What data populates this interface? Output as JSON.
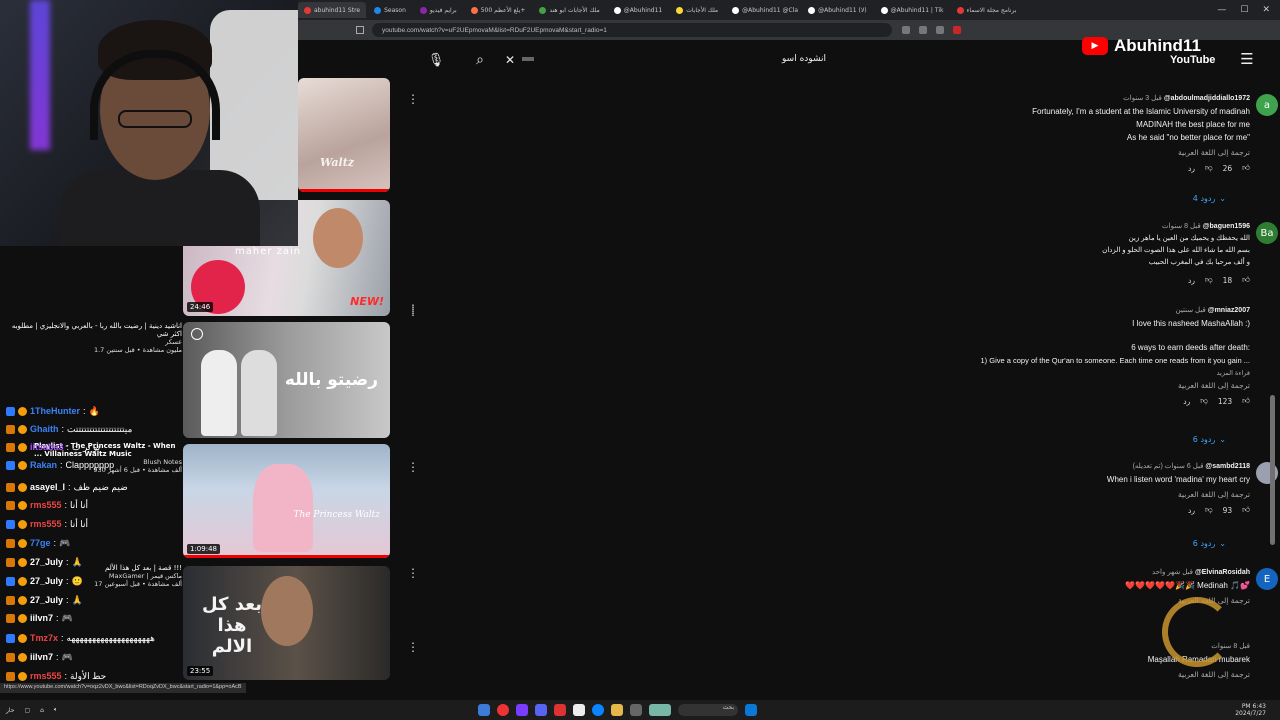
{
  "browser": {
    "tabs": [
      "abuhind11 Stre",
      "Season",
      "برايم فيديو",
      "يلع الأعظم 500+",
      "ملك الأجابات ابو هند",
      "@Abuhind11",
      "ملك الأجابات",
      "@Abuhind11 @Cla",
      "@Abuhind11 (لا)",
      "@Abuhind11 | Tik",
      "برنامج مجلة الاسماء"
    ],
    "active_tab": 0,
    "url": "youtube.com/watch?v=uF2UEpmovaM&list=RDuF2UEpmovaM&start_radio=1",
    "status_url": "https://www.youtube.com/watch?v=oqz2vDX_bwc&list=RDoqZvDX_bwc&start_radio=1&pp=oAcB"
  },
  "youtube": {
    "search_value": "انشوده اسو",
    "logo_text": "YouTube",
    "menu_icon": "hamburger-icon"
  },
  "overlay": {
    "channel_name": "Abuhind11"
  },
  "playlist": [
    {
      "duration": "",
      "overlay": "Waltz",
      "kind": "waltz1"
    },
    {
      "duration": "24:46",
      "overlay": "maher zain",
      "badge": "NEW!",
      "kind": "maher"
    },
    {
      "duration": "",
      "overlay": "رضيتو بالله",
      "kind": "radeet"
    },
    {
      "duration": "1:09:48",
      "overlay": "The Princess Waltz",
      "kind": "waltz2"
    },
    {
      "duration": "23:55",
      "overlay": "بعد كل هذا الالم",
      "kind": "baad"
    }
  ],
  "chat_cards": [
    {
      "title": "اناشيد دينية | رضيت بالله ربا - بالعربي والانجليزي | مطلوبه اكثر شي",
      "sub": "عسكر",
      "meta": "1.7 مليون مشاهدة • قبل سنتين"
    },
    {
      "title": "Playlist - The Princess Waltz - When ... Villainess Waltz Music",
      "sub": "Blush Notes",
      "meta": "930 ألف مشاهدة • قبل 6 أشهر"
    },
    {
      "title": "قصة | بعد كل هذا الألم !!!",
      "sub": "MaxGamer | ماكس قيمر",
      "meta": "17 ألف مشاهدة • قبل أسبوعين"
    }
  ],
  "chat": [
    {
      "user": "1TheHunter",
      "msg": "🔥",
      "color": "#3b82f6"
    },
    {
      "user": "Ghaith",
      "msg": "ميتتتتتتتتتتتتتتتتتتت",
      "color": "#3b82f6"
    },
    {
      "user": "iitsaba3",
      "msg": "تو تر ت",
      "color": "#a855f7"
    },
    {
      "user": "Rakan",
      "msg": "Clappppppp",
      "color": "#3b82f6"
    },
    {
      "user": "asayel_l",
      "msg": "ضيم ضيم ظف",
      "color": "#ffffff"
    },
    {
      "user": "rms555",
      "msg": "أنا أنا",
      "color": "#ef4444"
    },
    {
      "user": "rms555",
      "msg": "أنا أنا",
      "color": "#ef4444"
    },
    {
      "user": "77ge",
      "msg": "🎮",
      "color": "#3b82f6"
    },
    {
      "user": "27_July",
      "msg": "🙏",
      "color": "#ffffff"
    },
    {
      "user": "27_July",
      "msg": "🙂",
      "color": "#ffffff"
    },
    {
      "user": "27_July",
      "msg": "🙏",
      "color": "#ffffff"
    },
    {
      "user": "iilvn7",
      "msg": "🎮",
      "color": "#ffffff"
    },
    {
      "user": "Tmz7x",
      "msg": "ههههههههههههههههههههه",
      "color": "#ef4444"
    },
    {
      "user": "iilvn7",
      "msg": "🎮",
      "color": "#ffffff"
    },
    {
      "user": "rms555",
      "msg": "حط الأولة",
      "color": "#ef4444"
    }
  ],
  "comments": [
    {
      "author": "@abdoulmadjiddiallo1972",
      "time": "قبل 3 سنوات",
      "avatar": "a",
      "avatar_color": "#3fa34d",
      "lines": [
        "Fortunately, I'm a student at the Islamic University of madinah",
        "MADINAH the best place for me",
        "As he said \"no better place for me\""
      ],
      "translate": "ترجمة إلى اللغة العربية",
      "likes": "26",
      "reply": "رد",
      "replies": "4 ردود"
    },
    {
      "author": "@baguen1596",
      "time": "قبل 8 سنوات",
      "avatar": "Ba",
      "avatar_color": "#2e7d32",
      "lines": [
        "الله يحفظك و يحميك من العين يا ماهر زين",
        "بسم الله ما شاء الله على هذا الصوت الحلو و الزدان",
        "و ألف مرحبا بك في المغرب الحبيب"
      ],
      "translate": "",
      "likes": "18",
      "reply": "رد",
      "replies": ""
    },
    {
      "author": "@mniaz2007",
      "time": "قبل سنتين",
      "avatar": "",
      "avatar_color": "#0f0f0f",
      "lines": [
        "I love this nasheed MashaAllah :)",
        "",
        "6 ways to earn deeds after death:",
        "1) Give a copy of the Qur'an to someone. Each time one reads from it you gain ..."
      ],
      "more": "قراءة المزيد",
      "translate": "ترجمة إلى اللغة العربية",
      "likes": "123",
      "reply": "رد",
      "replies": "6 ردود"
    },
    {
      "author": "@sambd2118",
      "time": "قبل 6 سنوات (تم تعديله)",
      "avatar": "",
      "avatar_color": "#9aa0b0",
      "lines": [
        "When i listen word 'madina' my heart cry"
      ],
      "translate": "ترجمة إلى اللغة العربية",
      "likes": "93",
      "reply": "رد",
      "replies": "6 ردود"
    },
    {
      "author": "@ElvinaRosidah",
      "time": "قبل شهر واحد",
      "avatar": "E",
      "avatar_color": "#1565c0",
      "lines": [
        "❤️❤️❤️❤️❤️🎉🎉 Medinah 🎵💕"
      ],
      "translate": "ترجمة إلى اللغة العربية",
      "likes": "",
      "reply": "",
      "replies": ""
    },
    {
      "author": "",
      "time": "قبل 8 سنوات",
      "avatar": "",
      "avatar_color": "#0f0f0f",
      "lines": [
        "Maşallah Ramadan mubarek"
      ],
      "translate": "ترجمة إلى اللغة العربية",
      "likes": "",
      "reply": "",
      "replies": ""
    }
  ],
  "taskbar": {
    "weather": "حار",
    "time": "PM 6:43",
    "date": "2024/7/27",
    "search_label": "بحث"
  }
}
